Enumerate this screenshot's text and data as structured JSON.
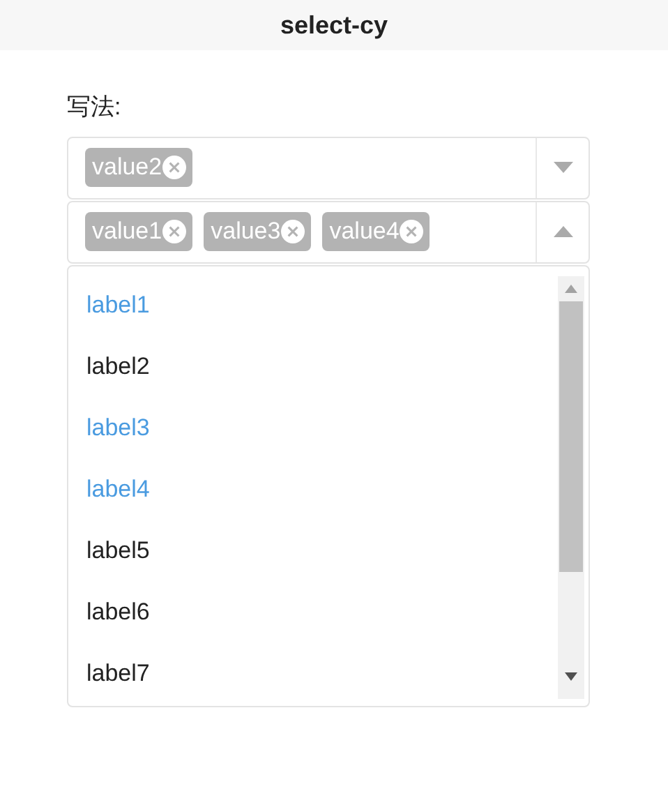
{
  "window": {
    "title": "select-cy"
  },
  "label": "写法:",
  "selects": [
    {
      "expanded": false,
      "tags": [
        "value2"
      ]
    },
    {
      "expanded": true,
      "tags": [
        "value1",
        "value3",
        "value4"
      ]
    }
  ],
  "options": [
    {
      "label": "label1",
      "selected": true
    },
    {
      "label": "label2",
      "selected": false
    },
    {
      "label": "label3",
      "selected": true
    },
    {
      "label": "label4",
      "selected": true
    },
    {
      "label": "label5",
      "selected": false
    },
    {
      "label": "label6",
      "selected": false
    },
    {
      "label": "label7",
      "selected": false
    }
  ]
}
